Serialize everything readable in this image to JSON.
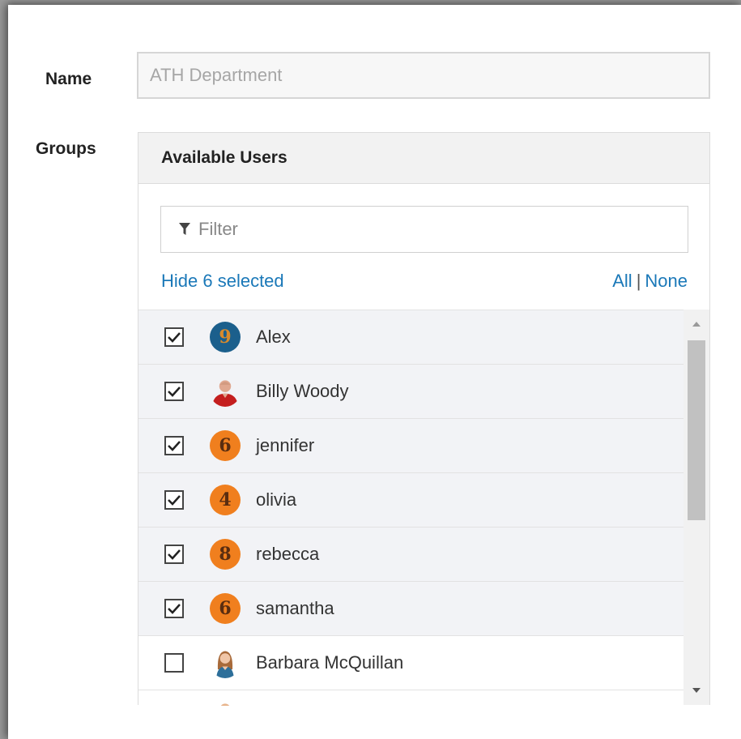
{
  "form": {
    "name_label": "Name",
    "name_placeholder": "ATH Department",
    "groups_label": "Groups"
  },
  "panel": {
    "header": "Available Users",
    "filter_placeholder": "Filter",
    "hide_selected": "Hide 6 selected",
    "all_label": "All",
    "separator": "|",
    "none_label": "None"
  },
  "users": [
    {
      "name": "Alex",
      "checked": true,
      "avatar": "9",
      "avatar_color": "#1b5f8c"
    },
    {
      "name": "Billy Woody",
      "checked": true,
      "avatar": "photo-man-icon"
    },
    {
      "name": "jennifer",
      "checked": true,
      "avatar": "6",
      "avatar_color": "#f07f1e"
    },
    {
      "name": "olivia",
      "checked": true,
      "avatar": "4",
      "avatar_color": "#f07f1e"
    },
    {
      "name": "rebecca",
      "checked": true,
      "avatar": "8",
      "avatar_color": "#f07f1e"
    },
    {
      "name": "samantha",
      "checked": true,
      "avatar": "6",
      "avatar_color": "#f07f1e"
    },
    {
      "name": "Barbara McQuillan",
      "checked": false,
      "avatar": "photo-woman-icon"
    }
  ],
  "colors": {
    "link": "#1a78b8",
    "selected_row_bg": "#f2f3f6"
  }
}
